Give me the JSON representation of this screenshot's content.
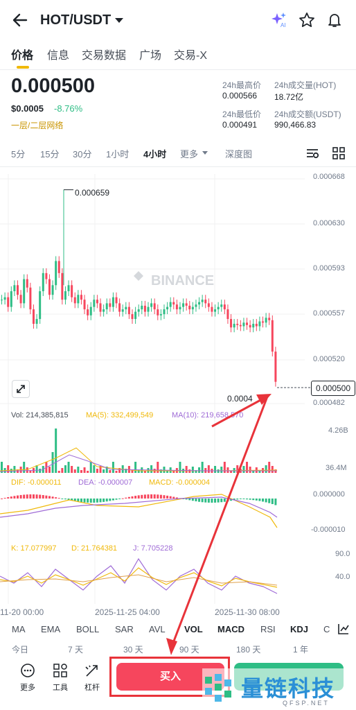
{
  "header": {
    "pair": "HOT/USDT"
  },
  "tabs": [
    "价格",
    "信息",
    "交易数据",
    "广场",
    "交易-X"
  ],
  "ticker": {
    "last_price": "0.000500",
    "usd_price": "$0.0005",
    "change": "-8.76%",
    "network": "一层/二层网络",
    "high_label": "24h最高价",
    "high": "0.000566",
    "low_label": "24h最低价",
    "low": "0.000491",
    "vol_label": "24h成交量(HOT)",
    "vol": "18.72亿",
    "turnover_label": "24h成交额(USDT)",
    "turnover": "990,466.83"
  },
  "timeframes": [
    "5分",
    "15分",
    "30分",
    "1小时",
    "4小时",
    "更多",
    "深度图"
  ],
  "chart_data": {
    "type": "candlestick",
    "watermark": "BINANCE",
    "y_ticks": [
      "0.000668",
      "0.000630",
      "0.000593",
      "0.000557",
      "0.000520",
      "0.000482"
    ],
    "ylim": [
      0.000482,
      0.000668
    ],
    "high_marker": "0.000659",
    "low_marker": "0.0004",
    "current_price": "0.000500",
    "x_labels": [
      "11-20 00:00",
      "2025-11-25 04:00",
      "2025-11-30 08:00"
    ],
    "volume": {
      "vol": "Vol: 214,385,815",
      "ma5": "MA(5): 332,499,549",
      "ma10": "MA(10): 219,658,570",
      "ticks": [
        "4.26B",
        "36.4M"
      ]
    },
    "macd": {
      "dif": "DIF: -0.000011",
      "dea": "DEA: -0.000007",
      "macd": "MACD: -0.000004",
      "ticks": [
        "0.000000",
        "-0.000010"
      ]
    },
    "kdj": {
      "k": "K: 17.077997",
      "d": "D: 21.764381",
      "j": "J: 7.705228",
      "ticks": [
        "90.0",
        "40.0"
      ]
    }
  },
  "indicator_tabs": [
    "MA",
    "EMA",
    "BOLL",
    "SAR",
    "AVL",
    "VOL",
    "MACD",
    "RSI",
    "KDJ",
    "C"
  ],
  "ranges": [
    "今日",
    "7 天",
    "30 天",
    "90 天",
    "180 天",
    "1 年"
  ],
  "tools": [
    "更多",
    "工具",
    "杠杆"
  ],
  "buy_label": "买入",
  "watermark_logo": {
    "name": "量链科技",
    "site": "QFSP.NET"
  },
  "colors": {
    "up": "#2ebd85",
    "down": "#f6465d",
    "accent": "#f0b90b"
  }
}
